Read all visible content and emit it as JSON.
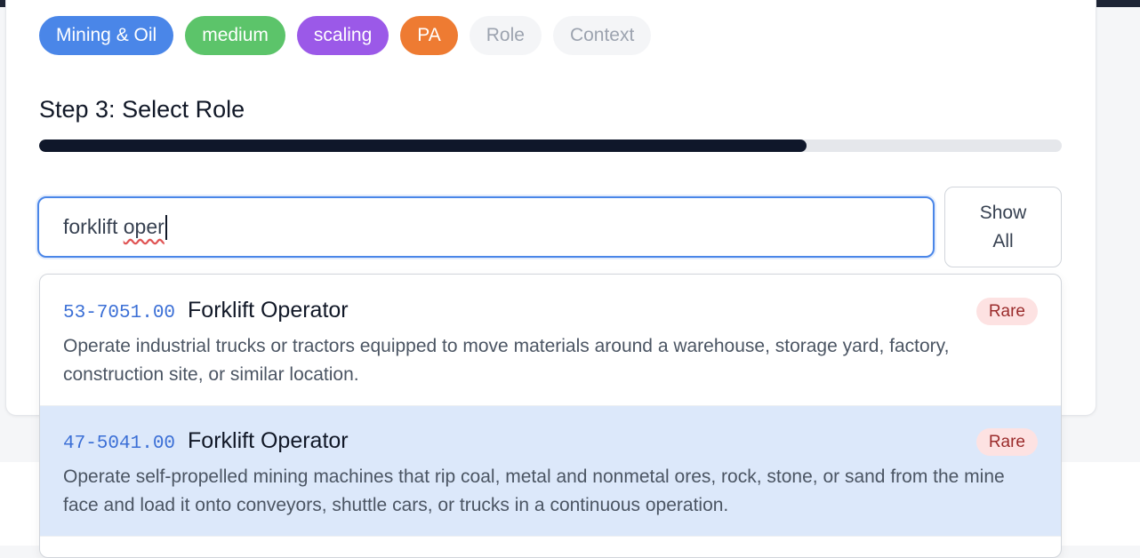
{
  "chips": [
    {
      "label": "Mining & Oil",
      "state": "done"
    },
    {
      "label": "medium",
      "state": "done"
    },
    {
      "label": "scaling",
      "state": "done"
    },
    {
      "label": "PA",
      "state": "done"
    },
    {
      "label": "Role",
      "state": "pending"
    },
    {
      "label": "Context",
      "state": "pending"
    }
  ],
  "chip_colors": [
    "#4a86e8",
    "#5cc46a",
    "#9b59e8",
    "#ee7b32"
  ],
  "step": {
    "title": "Step 3: Select Role",
    "progress": 0.75
  },
  "search": {
    "value_prefix": "forklift ",
    "value_misspelled": "oper"
  },
  "show_all": {
    "line1": "Show",
    "line2": "All"
  },
  "results": [
    {
      "code": "53-7051.00",
      "title": "Forklift Operator",
      "badge": "Rare",
      "description": "Operate industrial trucks or tractors equipped to move materials around a warehouse, storage yard, factory, construction site, or similar location."
    },
    {
      "code": "47-5041.00",
      "title": "Forklift Operator",
      "badge": "Rare",
      "description": "Operate self-propelled mining machines that rip coal, metal and nonmetal ores, rock, stone, or sand from the mine face and load it onto conveyors, shuttle cars, or trucks in a continuous operation."
    }
  ]
}
